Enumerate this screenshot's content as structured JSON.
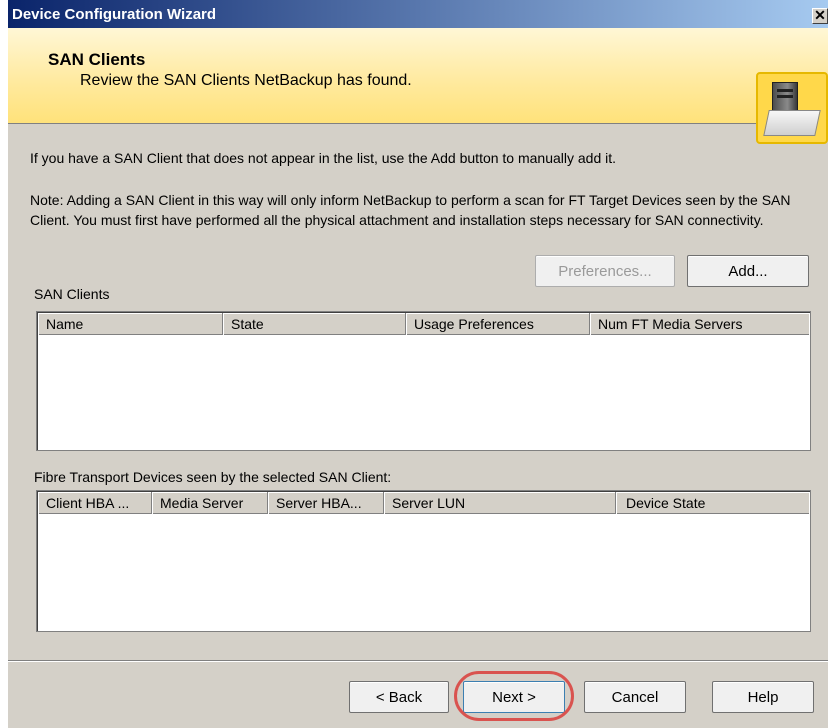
{
  "window": {
    "title": "Device Configuration Wizard",
    "close_glyph": "✕"
  },
  "header": {
    "title": "SAN Clients",
    "subtitle": "Review the SAN Clients NetBackup has found.",
    "graphic_icon": "server-storage-icon"
  },
  "body": {
    "intro": "If you have a SAN Client that does not appear in the list, use the Add button to manually add it.",
    "note": "Note: Adding a SAN Client in this way will only inform NetBackup to perform a scan for FT Target Devices seen by the SAN Client. You must first have performed all the physical attachment and installation steps necessary for SAN connectivity."
  },
  "buttons": {
    "preferences": "Preferences...",
    "add": "Add...",
    "back": "< Back",
    "next": "Next >",
    "cancel": "Cancel",
    "help": "Help"
  },
  "san_clients": {
    "label": "SAN Clients",
    "columns": [
      "Name",
      "State",
      "Usage Preferences",
      "Num FT Media Servers"
    ],
    "rows": []
  },
  "ft_devices": {
    "label": "Fibre Transport Devices seen by the selected SAN Client:",
    "columns": [
      "Client HBA ...",
      "Media Server",
      "Server HBA...",
      "Server LUN",
      "Device State"
    ],
    "rows": []
  },
  "colors": {
    "title_bar": "#0a246a",
    "header_bg": "#ffeaa0",
    "highlight": "#d9534f"
  }
}
